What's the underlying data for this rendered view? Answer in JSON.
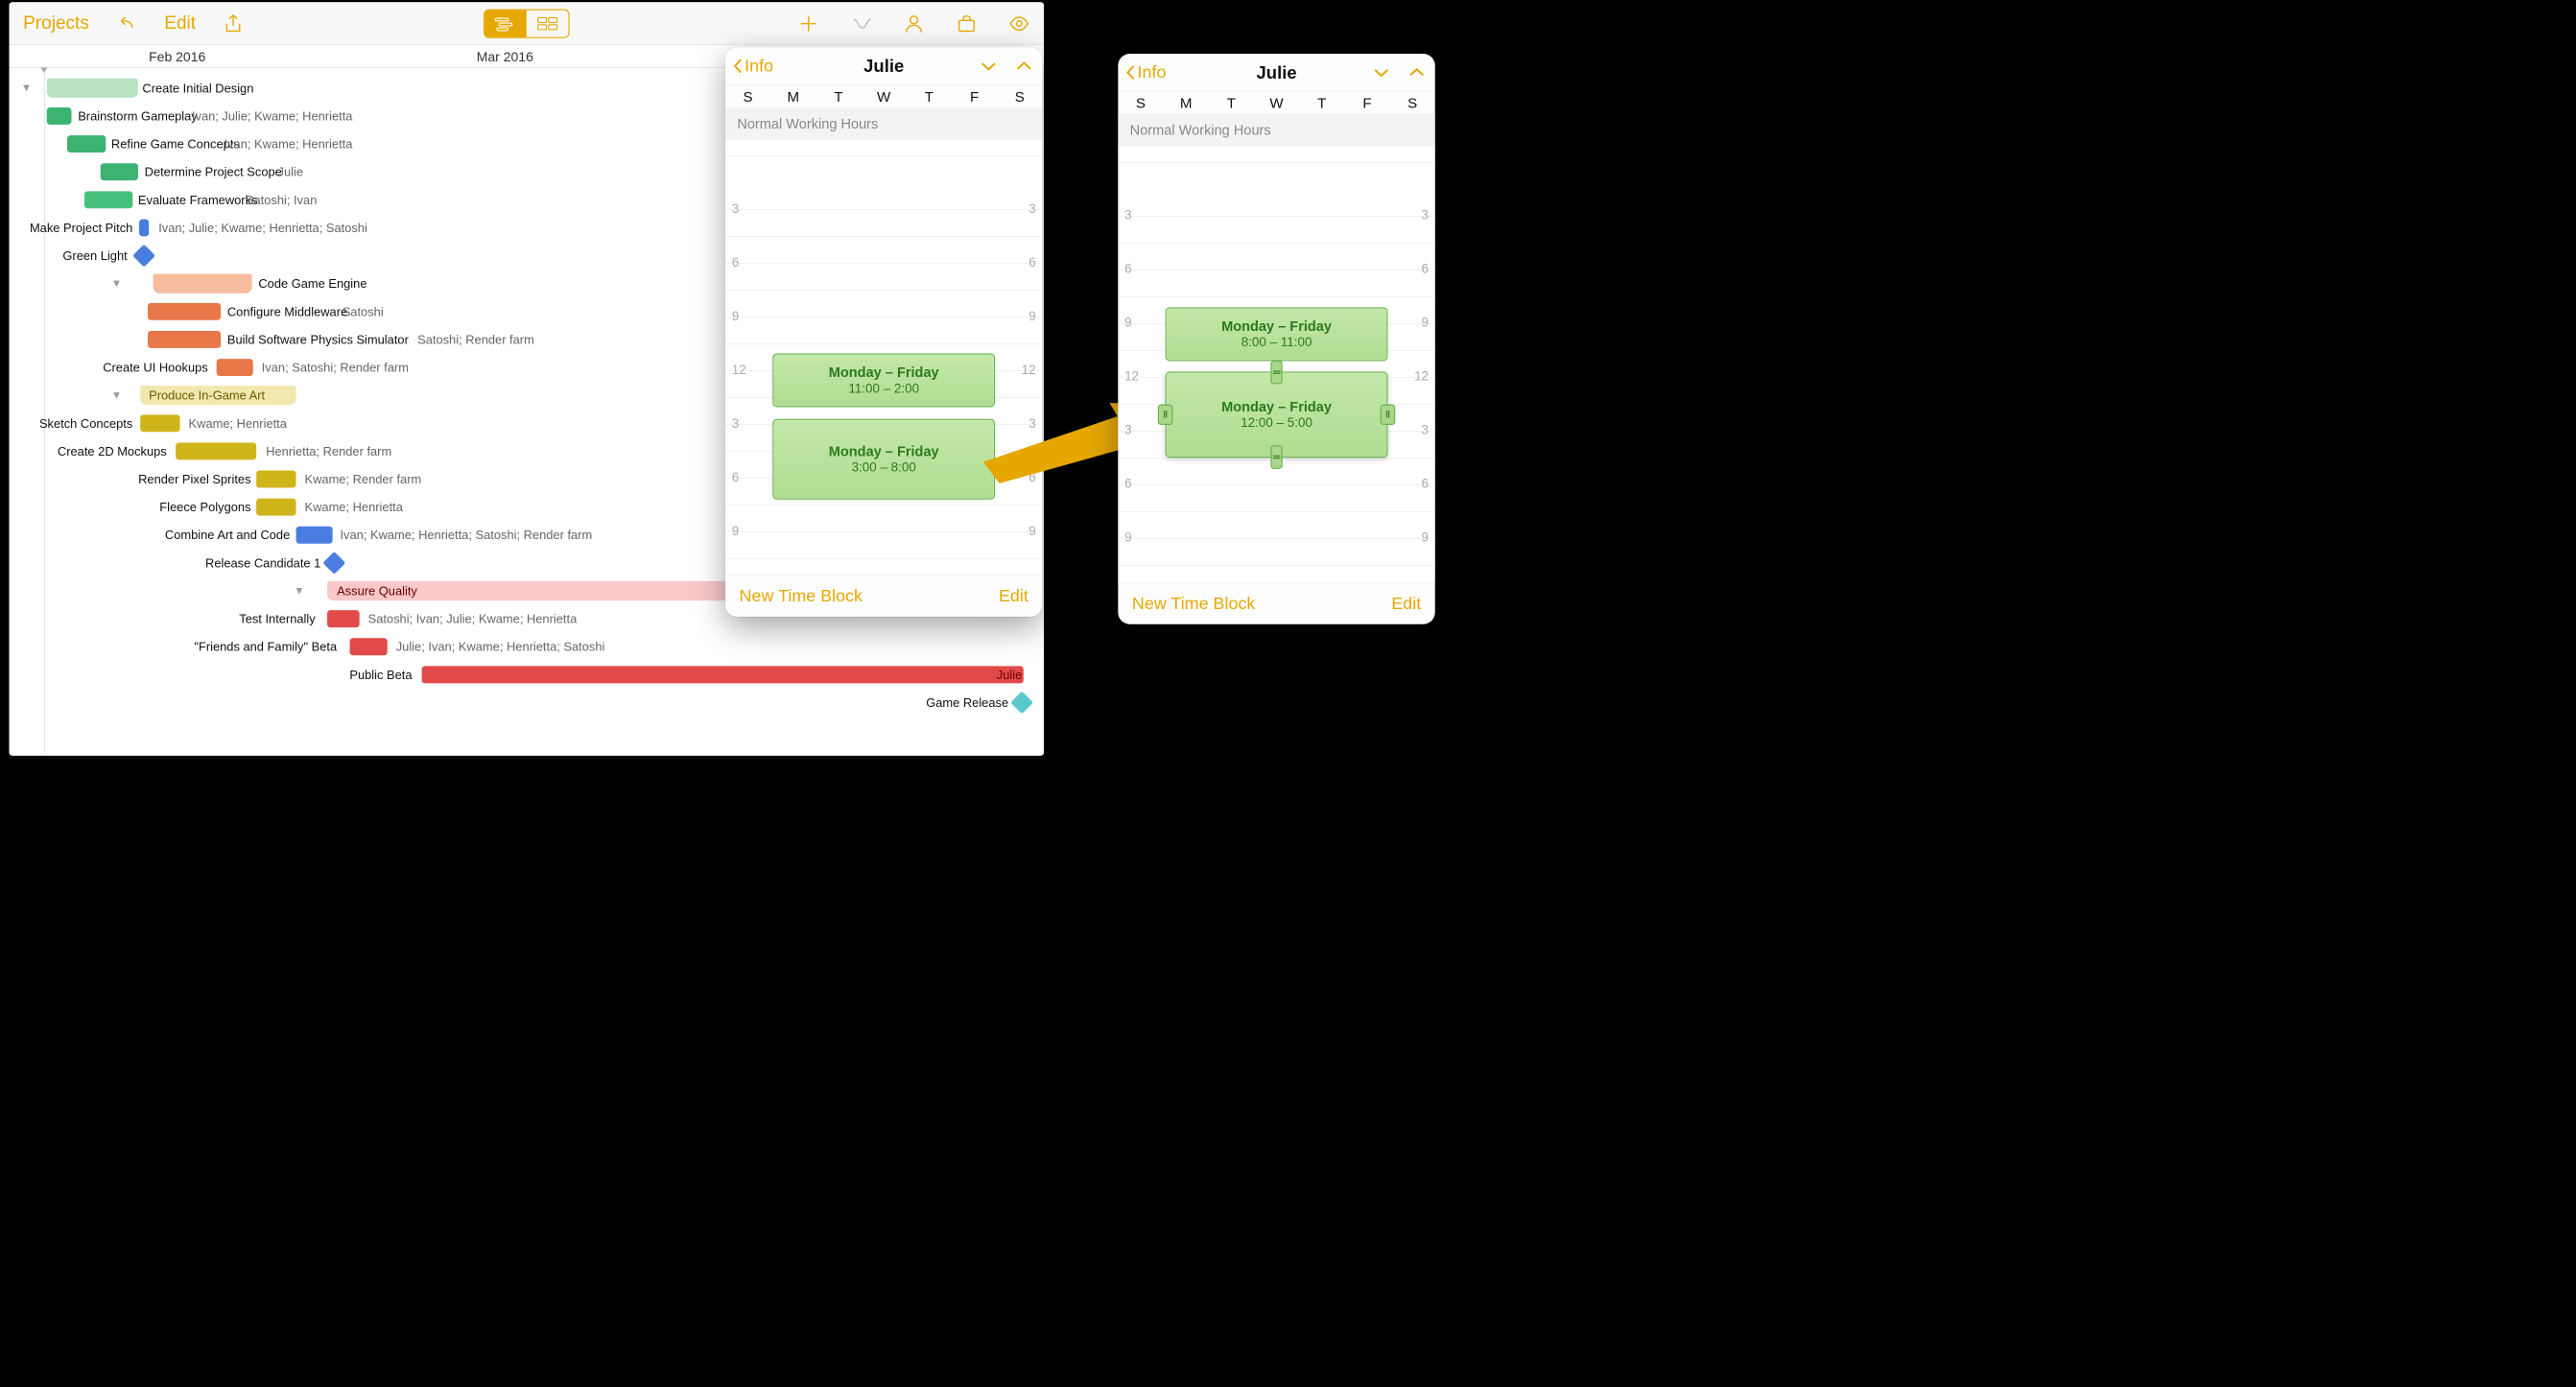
{
  "toolbar": {
    "projects": "Projects",
    "edit": "Edit"
  },
  "timeline": {
    "month1": "Feb 2016",
    "month2": "Mar 2016"
  },
  "tasks": [
    {
      "name": "Create Initial Design",
      "assign": ""
    },
    {
      "name": "Brainstorm Gameplay",
      "assign": "Ivan; Julie; Kwame; Henrietta"
    },
    {
      "name": "Refine Game Concepts",
      "assign": "Ivan; Kwame; Henrietta"
    },
    {
      "name": "Determine Project Scope",
      "assign": "Julie"
    },
    {
      "name": "Evaluate Frameworks",
      "assign": "Satoshi; Ivan"
    },
    {
      "name": "Make Project Pitch",
      "assign": "Ivan; Julie; Kwame; Henrietta; Satoshi"
    },
    {
      "name": "Green Light",
      "assign": ""
    },
    {
      "name": "Code Game Engine",
      "assign": ""
    },
    {
      "name": "Configure Middleware",
      "assign": "Satoshi"
    },
    {
      "name": "Build Software Physics Simulator",
      "assign": "Satoshi; Render farm"
    },
    {
      "name": "Create UI Hookups",
      "assign": "Ivan; Satoshi; Render farm"
    },
    {
      "name": "Produce In-Game Art",
      "assign": ""
    },
    {
      "name": "Sketch Concepts",
      "assign": "Kwame; Henrietta"
    },
    {
      "name": "Create 2D Mockups",
      "assign": "Henrietta; Render farm"
    },
    {
      "name": "Render Pixel Sprites",
      "assign": "Kwame; Render farm"
    },
    {
      "name": "Fleece Polygons",
      "assign": "Kwame; Henrietta"
    },
    {
      "name": "Combine Art and Code",
      "assign": "Ivan; Kwame; Henrietta; Satoshi; Render farm"
    },
    {
      "name": "Release Candidate 1",
      "assign": ""
    },
    {
      "name": "Assure Quality",
      "assign": ""
    },
    {
      "name": "Test Internally",
      "assign": "Satoshi; Ivan; Julie; Kwame; Henrietta"
    },
    {
      "name": "\"Friends and Family\" Beta",
      "assign": "Julie; Ivan; Kwame; Henrietta; Satoshi"
    },
    {
      "name": "Public Beta",
      "assign": "Julie"
    },
    {
      "name": "Game Release",
      "assign": ""
    }
  ],
  "popover": {
    "back": "Info",
    "title": "Julie",
    "days": [
      "S",
      "M",
      "T",
      "W",
      "T",
      "F",
      "S"
    ],
    "section": "Normal Working Hours",
    "hours": [
      "3",
      "6",
      "9",
      "12",
      "3",
      "6",
      "9"
    ],
    "block1_title": "Monday – Friday",
    "block1_range": "11:00 – 2:00",
    "block2_title": "Monday – Friday",
    "block2_range": "3:00 – 8:00",
    "newblock": "New Time Block",
    "edit": "Edit"
  },
  "popover2": {
    "back": "Info",
    "title": "Julie",
    "section": "Normal Working Hours",
    "block1_title": "Monday – Friday",
    "block1_range": "8:00 – 11:00",
    "block2_title": "Monday – Friday",
    "block2_range": "12:00 – 5:00",
    "newblock": "New Time Block",
    "edit": "Edit"
  }
}
